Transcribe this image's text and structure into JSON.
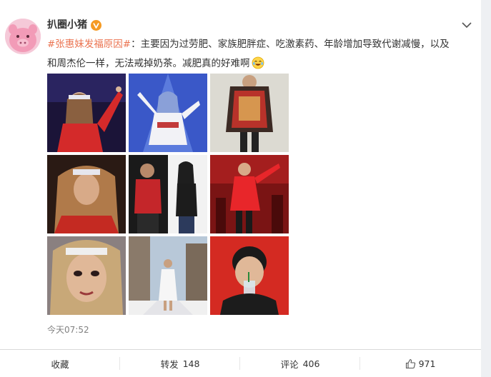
{
  "post": {
    "username": "扒圈小猪",
    "badge_icon": "verified-v-icon",
    "text_hashtag": "#张惠妹发福原因#",
    "text_line1_rest": "：主要因为过劳肥、家族肥胖症、吃激素药、年龄增加导致代谢减慢，以及",
    "text_line2": "和周杰伦一样，无法戒掉奶茶。减肥真的好难啊",
    "emoji": "laugh-crying-emoji",
    "timestamp": "今天07:52"
  },
  "actions": {
    "favorite_label": "收藏",
    "repost_label": "转发",
    "repost_count": "148",
    "comment_label": "评论",
    "comment_count": "406",
    "like_count": "971"
  },
  "colors": {
    "hashtag": "#eb7350",
    "badge": "#f59a23",
    "text": "#333333",
    "muted": "#808080"
  }
}
